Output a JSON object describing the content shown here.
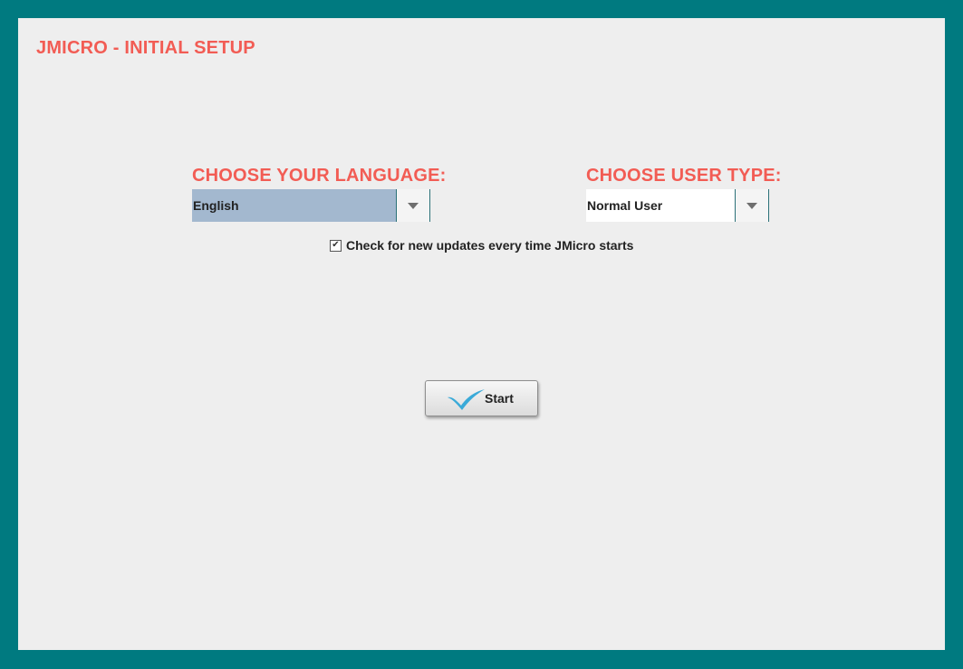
{
  "app": {
    "title": "JMICRO - INITIAL SETUP"
  },
  "language": {
    "label": "CHOOSE YOUR LANGUAGE:",
    "selected": "English"
  },
  "user_type": {
    "label": "CHOOSE USER TYPE:",
    "selected": "Normal User"
  },
  "updates": {
    "label": "Check for new updates every time JMicro starts",
    "checked": true,
    "check_glyph": "✔"
  },
  "start_button": {
    "label": "Start",
    "icon": "checkmark-icon"
  },
  "colors": {
    "frame": "#007a80",
    "panel": "#eeeeee",
    "accent": "#f25c54",
    "selection": "#a3b8cf",
    "check_icon": "#3aaad8"
  }
}
